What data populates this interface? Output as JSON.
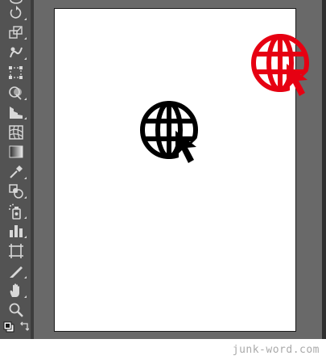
{
  "toolbar": {
    "tools": [
      {
        "name": "lasso-tool-icon"
      },
      {
        "name": "rotate-tool-icon"
      },
      {
        "name": "scale-tool-icon"
      },
      {
        "name": "warp-tool-icon"
      },
      {
        "name": "free-transform-tool-icon"
      },
      {
        "name": "shape-builder-tool-icon"
      },
      {
        "name": "perspective-grid-tool-icon"
      },
      {
        "name": "mesh-tool-icon"
      },
      {
        "name": "gradient-tool-icon"
      },
      {
        "name": "eyedropper-tool-icon"
      },
      {
        "name": "blend-tool-icon"
      },
      {
        "name": "symbol-sprayer-tool-icon"
      },
      {
        "name": "column-graph-tool-icon"
      },
      {
        "name": "artboard-tool-icon"
      },
      {
        "name": "slice-tool-icon"
      },
      {
        "name": "hand-tool-icon"
      },
      {
        "name": "zoom-tool-icon"
      },
      {
        "name": "fill-stroke-swatch-icon"
      },
      {
        "name": "swap-fill-stroke-icon"
      }
    ]
  },
  "artwork": {
    "black_icon": {
      "name": "globe-cursor-icon",
      "color": "#000000"
    },
    "red_icon": {
      "name": "globe-cursor-icon",
      "color": "#e60012"
    }
  },
  "footer": {
    "watermark": "junk-word.com"
  }
}
